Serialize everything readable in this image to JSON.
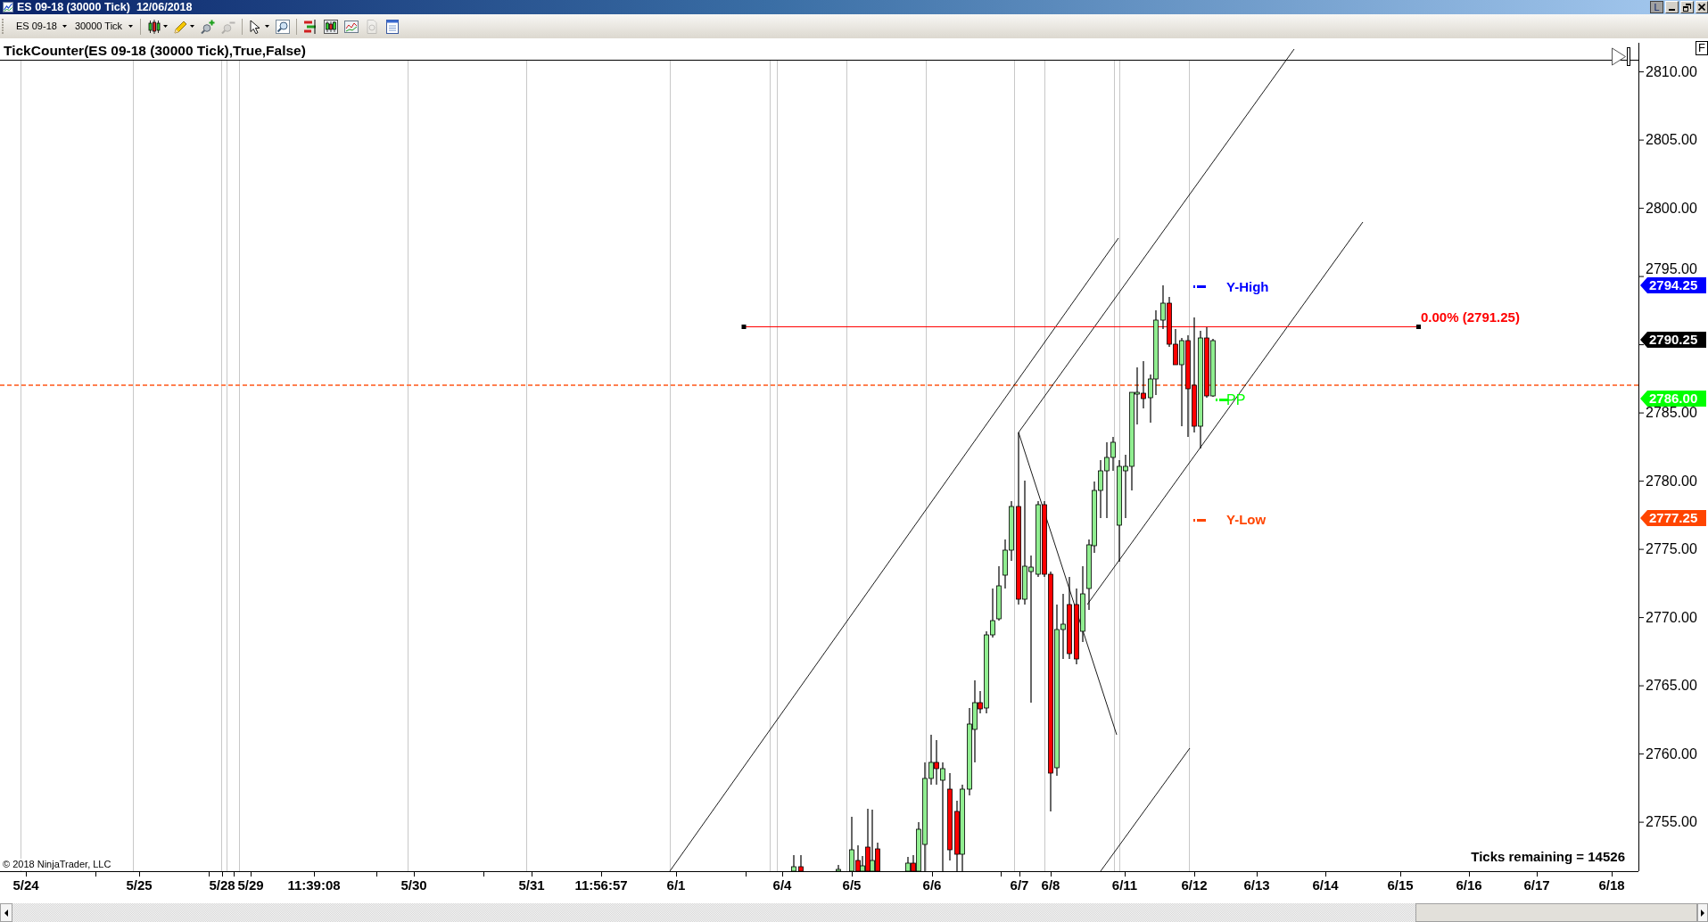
{
  "window": {
    "title": "ES 09-18 (30000 Tick)  12/06/2018",
    "buttons": [
      {
        "label": "L"
      }
    ]
  },
  "toolbar": {
    "instrument": "ES 09-18",
    "interval": "30000 Tick",
    "tools": [
      {
        "kind": "separator"
      },
      {
        "kind": "candles",
        "disabled": false,
        "menu": true
      },
      {
        "kind": "pencil",
        "disabled": false,
        "menu": true
      },
      {
        "kind": "magnifier-plus",
        "disabled": false
      },
      {
        "kind": "magnifier-minus",
        "disabled": true
      },
      {
        "kind": "separator"
      },
      {
        "kind": "pointer",
        "disabled": false,
        "menu": true
      },
      {
        "kind": "zoom",
        "disabled": false
      },
      {
        "kind": "separator"
      },
      {
        "kind": "bars",
        "disabled": false
      },
      {
        "kind": "candles-box",
        "disabled": false
      },
      {
        "kind": "line-chart",
        "disabled": false
      },
      {
        "kind": "coin",
        "disabled": true
      },
      {
        "kind": "properties",
        "disabled": false
      }
    ]
  },
  "chart": {
    "indicator_label": "TickCounter(ES 09-18 (30000 Tick),True,False)",
    "fibonacci_label": "0.00% (2791.25)",
    "annotations": [
      {
        "kind": "session",
        "text": "Y-High",
        "color": "#0000ff"
      },
      {
        "kind": "pivot",
        "text": "PP",
        "color": "#00ff00"
      },
      {
        "kind": "session",
        "text": "Y-Low",
        "color": "#ff4500"
      }
    ],
    "ticks_remaining": "Ticks remaining = 14526",
    "copyright": "© 2018 NinjaTrader, LLC",
    "corner_button": "F"
  },
  "price_axis": {
    "labels": [
      "2810.00",
      "2805.00",
      "2800.00",
      "2795.00",
      "2785.00",
      "2780.00",
      "2775.00",
      "2770.00",
      "2765.00",
      "2760.00",
      "2755.00"
    ],
    "markers": [
      {
        "text": "2794.25",
        "color": "#0000ff"
      },
      {
        "text": "2790.25",
        "color": "#000000"
      },
      {
        "text": "2786.00",
        "color": "#00ff00"
      },
      {
        "text": "2777.25",
        "color": "#ff4500"
      }
    ]
  },
  "time_axis": {
    "labels": [
      "5/24",
      "5/25",
      "5/28",
      "5/29",
      "11:39:08",
      "5/30",
      "5/31",
      "11:56:57",
      "6/1",
      "6/4",
      "6/5",
      "6/6",
      "6/7",
      "6/8",
      "6/11",
      "6/12",
      "6/13",
      "6/14",
      "6/15",
      "6/16",
      "6/17",
      "6/18"
    ]
  }
}
